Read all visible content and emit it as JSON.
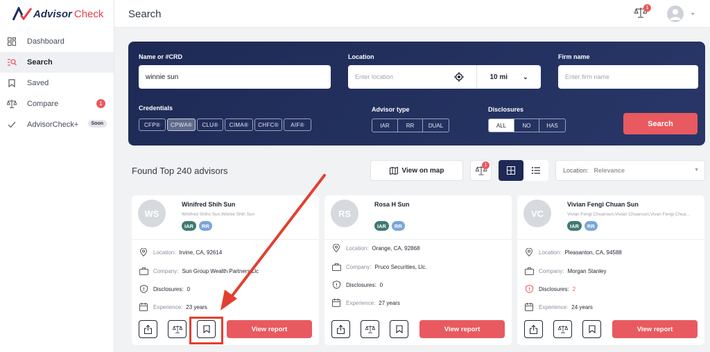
{
  "brand": {
    "name_bold": "Advisor",
    "name_rest": "Check"
  },
  "header": {
    "title": "Search",
    "compare_count": "1"
  },
  "sidebar": {
    "items": [
      {
        "label": "Dashboard"
      },
      {
        "label": "Search"
      },
      {
        "label": "Saved"
      },
      {
        "label": "Compare",
        "badge": "1"
      },
      {
        "label": "AdvisorCheck+",
        "badge": "Soon"
      }
    ]
  },
  "search_panel": {
    "name_label": "Name or #CRD",
    "name_value": "winnie sun",
    "location_label": "Location",
    "location_placeholder": "Enter location",
    "radius": "10 mi",
    "firm_label": "Firm name",
    "firm_placeholder": "Enter firm name",
    "credentials_label": "Credentials",
    "credentials": [
      "CFP®",
      "CPWA®",
      "CLU®",
      "CIMA®",
      "CHFC®",
      "AIF®"
    ],
    "selected_credential": "CPWA®",
    "advisor_type_label": "Advisor type",
    "advisor_types": [
      "IAR",
      "RR",
      "DUAL"
    ],
    "disclosures_label": "Disclosures",
    "disclosure_options": [
      "ALL",
      "NO",
      "HAS"
    ],
    "selected_disclosure": "ALL",
    "search_button": "Search"
  },
  "results": {
    "found_text": "Found Top 240 advisors",
    "view_map": "View on map",
    "compare_count": "1",
    "sort_label": "Location:",
    "sort_value": "Relevance"
  },
  "labels": {
    "location": "Location:",
    "company": "Company:",
    "disclosures": "Disclosures:",
    "experience": "Experience:",
    "view_report": "View report"
  },
  "cards": [
    {
      "initials": "WS",
      "name": "Winifred Shih Sun",
      "aka": "Winifred Shihs Sun,Winnie Shih Sun",
      "tags": [
        "IAR",
        "RR"
      ],
      "location": "Irvine, CA, 92614",
      "company": "Sun Group Wealth Partners Llc",
      "disclosures": "0",
      "experience": "23 years"
    },
    {
      "initials": "RS",
      "name": "Rosa H Sun",
      "aka": "",
      "tags": [
        "IAR",
        "RR"
      ],
      "location": "Orange, CA, 92868",
      "company": "Pruco Securities, Llc.",
      "disclosures": "0",
      "experience": "27 years"
    },
    {
      "initials": "VC",
      "name": "Vivian Fengi Chuan Sun",
      "aka": "Vivian Fengi Chuansun,Vivian Chuansun,Vivan Fengi Chuansun",
      "tags": [
        "IAR",
        "RR"
      ],
      "location": "Pleasanton, CA, 94588",
      "company": "Morgan Stanley",
      "disclosures": "2",
      "experience": "24 years"
    }
  ],
  "colors": {
    "accent": "#e85a5f",
    "navy": "#1e2a55",
    "annotation": "#e2402f"
  }
}
